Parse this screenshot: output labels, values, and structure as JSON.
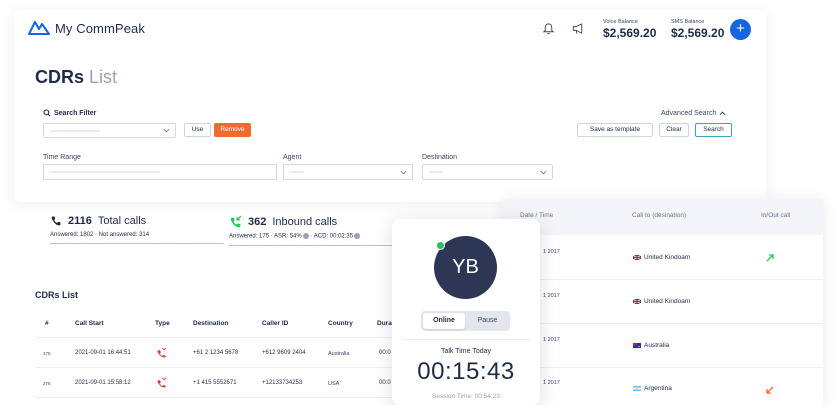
{
  "app": {
    "name": "My CommPeak"
  },
  "header": {
    "voice_balance_label": "Voice Balance",
    "voice_balance": "$2,569.20",
    "sms_balance_label": "SMS Balance",
    "sms_balance": "$2,569.20",
    "add_label": "+"
  },
  "page": {
    "title_bold": "CDRs",
    "title_light": " List"
  },
  "search_filter": {
    "label": "Search Filter",
    "use_label": "Use",
    "remove_label": "Remove",
    "advanced_label": "Advanced Search",
    "save_template_label": "Save as template",
    "clear_label": "Clear",
    "search_label": "Search"
  },
  "filters": {
    "time_range": "Time Range",
    "agent": "Agent",
    "destination": "Destination"
  },
  "stats": {
    "total": {
      "value": "2116",
      "label": "Total calls",
      "answered": "Answered: 1802",
      "not_answered": "Not answered: 314"
    },
    "inbound": {
      "value": "362",
      "label": "Inbound calls",
      "answered": "Answered: 175",
      "asr": "ASR: 54%",
      "acd": "ACD: 00:02:35"
    }
  },
  "cdrs_list": {
    "title": "CDRs List",
    "columns": [
      "#",
      "Call Start",
      "Type",
      "Destination",
      "Caller ID",
      "Country",
      "Dura"
    ],
    "rows": [
      {
        "num": "275",
        "start": "2021-09-01 16:44:51",
        "destination": "+61 2 1234 5678",
        "caller_id": "+612 9609 2404",
        "country": "Australia",
        "duration": "00:0"
      },
      {
        "num": "276",
        "start": "2021-09-01 15:58:12",
        "destination": "+1 415 5552671",
        "caller_id": "+12133734253",
        "country": "USA",
        "duration": "00:0"
      }
    ]
  },
  "right_table": {
    "columns": [
      "Date / Time",
      "Call to (desination)",
      "In/Out call"
    ],
    "rows": [
      {
        "date": "1 2017",
        "destination": "United Kindoam"
      },
      {
        "date": "1 2017",
        "destination": "United Kindoam"
      },
      {
        "date": "1 2017",
        "destination": "Australia"
      },
      {
        "date": "1 2017",
        "destination": "Argentina"
      }
    ]
  },
  "agent": {
    "initials": "YB",
    "online_label": "Online",
    "pause_label": "Pause",
    "talk_time_label": "Talk Time Today",
    "talk_time": "00:15:43",
    "session_time": "Session Time: 00:54:23"
  },
  "colors": {
    "accent": "#1565e0",
    "remove": "#f26a2e",
    "avatar": "#2e3656",
    "online": "#22c55e",
    "outbound_arrow": "#22c55e",
    "inbound_arrow": "#f26a2e"
  }
}
